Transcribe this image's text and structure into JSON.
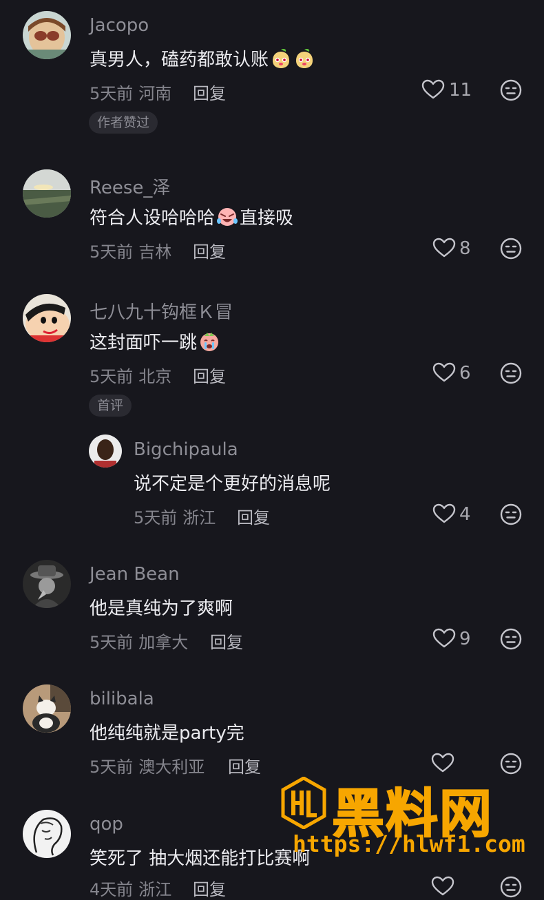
{
  "comments": [
    {
      "user": "Jacopo",
      "text": "真男人，磕药都敢认账",
      "time": "5天前",
      "location": "河南",
      "reply": "回复",
      "likes": "11",
      "tag": "作者赞过"
    },
    {
      "user": "Reese_泽",
      "text_before": "符合人设哈哈哈",
      "text_after": "直接吸",
      "time": "5天前",
      "location": "吉林",
      "reply": "回复",
      "likes": "8"
    },
    {
      "user": "七八九十钩框Ｋ冒",
      "text": "这封面吓一跳",
      "time": "5天前",
      "location": "北京",
      "reply": "回复",
      "likes": "6",
      "tag": "首评"
    },
    {
      "user": "Bigchipaula",
      "text": "说不定是个更好的消息呢",
      "time": "5天前",
      "location": "浙江",
      "reply": "回复",
      "likes": "4"
    },
    {
      "user": "Jean Bean",
      "text": "他是真纯为了爽啊",
      "time": "5天前",
      "location": "加拿大",
      "reply": "回复",
      "likes": "9"
    },
    {
      "user": "bilibala",
      "text": "他纯纯就是party完",
      "time": "5天前",
      "location": "澳大利亚",
      "reply": "回复",
      "likes": ""
    },
    {
      "user": "qop",
      "text": "笑死了 抽大烟还能打比赛啊",
      "time": "4天前",
      "location": "浙江",
      "reply": "回复",
      "likes": ""
    }
  ],
  "watermark": {
    "title": "黑料网",
    "url": "https://hlwf1.com"
  },
  "colors": {
    "background": "#17171d",
    "accent": "#f7a600"
  }
}
